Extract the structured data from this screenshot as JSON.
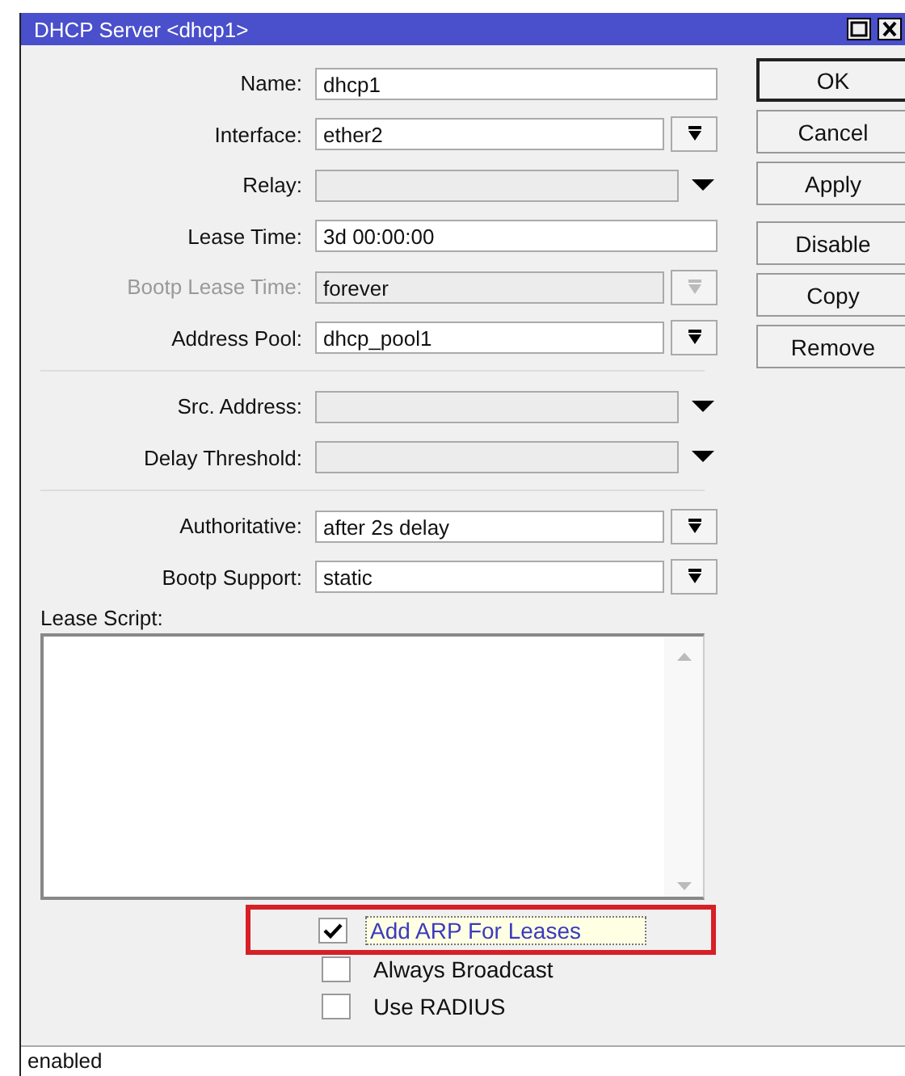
{
  "window": {
    "title": "DHCP Server <dhcp1>"
  },
  "field_groups": [
    [
      {
        "label": "Name:",
        "kind": "text",
        "value": "dhcp1",
        "disabled": false
      },
      {
        "label": "Interface:",
        "kind": "select",
        "value": "ether2",
        "disabled": false
      },
      {
        "label": "Relay:",
        "kind": "combo",
        "disabled": false
      },
      {
        "label": "Lease Time:",
        "kind": "text",
        "value": "3d 00:00:00",
        "disabled": false
      },
      {
        "label": "Bootp Lease Time:",
        "kind": "select",
        "value": "forever",
        "disabled": true
      },
      {
        "label": "Address Pool:",
        "kind": "select",
        "value": "dhcp_pool1",
        "disabled": false
      }
    ],
    [
      {
        "label": "Src. Address:",
        "kind": "combo",
        "disabled": false
      },
      {
        "label": "Delay Threshold:",
        "kind": "combo",
        "disabled": false
      }
    ],
    [
      {
        "label": "Authoritative:",
        "kind": "select",
        "value": "after 2s delay",
        "disabled": false
      },
      {
        "label": "Bootp Support:",
        "kind": "select",
        "value": "static",
        "disabled": false
      }
    ]
  ],
  "lease_script": {
    "label": "Lease Script:"
  },
  "checkboxes": [
    {
      "label": "Add ARP For Leases",
      "checked": true,
      "focused": true,
      "highlighted": true
    },
    {
      "label": "Always Broadcast",
      "checked": false,
      "focused": false,
      "highlighted": false
    },
    {
      "label": "Use RADIUS",
      "checked": false,
      "focused": false,
      "highlighted": false
    }
  ],
  "buttons": [
    [
      "OK",
      "Cancel",
      "Apply"
    ],
    [
      "Disable",
      "Copy",
      "Remove"
    ]
  ],
  "status_bar": "enabled"
}
